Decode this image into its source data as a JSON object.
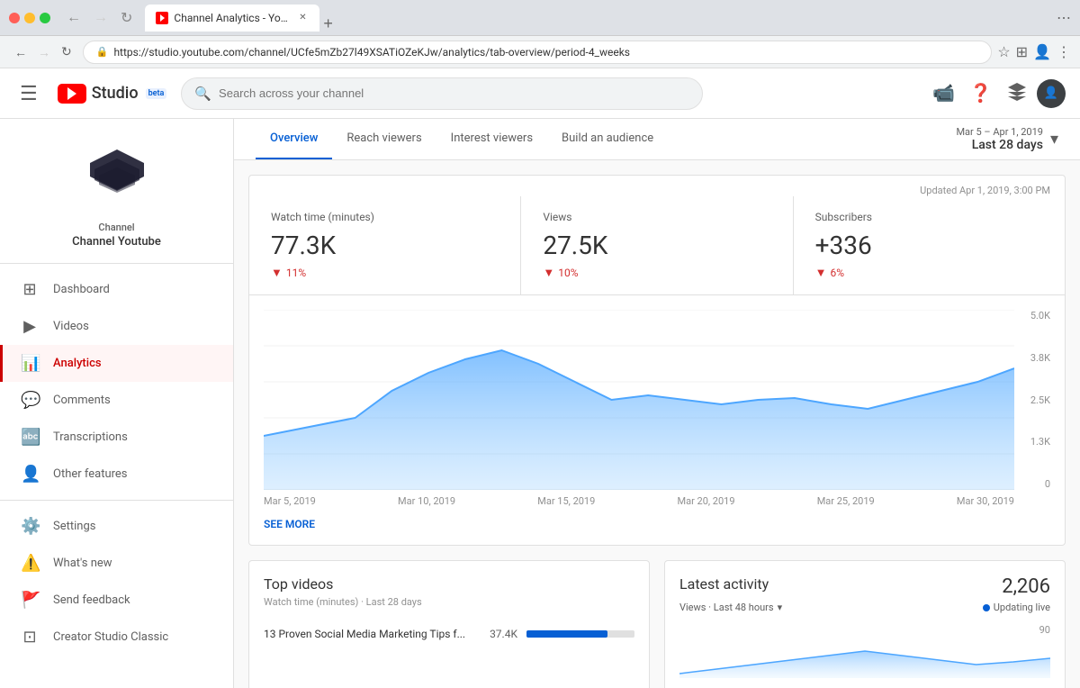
{
  "browser": {
    "tab_title": "Channel Analytics - YouTube S...",
    "url": "https://studio.youtube.com/channel/UCfe5mZb27l49XSATiOZeKJw/analytics/tab-overview/period-4_weeks",
    "back_label": "←",
    "forward_label": "→",
    "reload_label": "↻",
    "new_tab_label": "+"
  },
  "topbar": {
    "search_placeholder": "Search across your channel",
    "logo_text": "Studio",
    "beta_label": "beta",
    "create_icon": "video-camera-icon",
    "help_icon": "help-circle-icon",
    "layers_icon": "layers-icon"
  },
  "sidebar": {
    "channel_label": "Channel",
    "channel_name": "Channel Youtube",
    "items": [
      {
        "id": "dashboard",
        "label": "Dashboard",
        "icon": "dashboard-icon"
      },
      {
        "id": "videos",
        "label": "Videos",
        "icon": "videos-icon"
      },
      {
        "id": "analytics",
        "label": "Analytics",
        "icon": "analytics-icon",
        "active": true
      },
      {
        "id": "comments",
        "label": "Comments",
        "icon": "comments-icon"
      },
      {
        "id": "transcriptions",
        "label": "Transcriptions",
        "icon": "transcriptions-icon"
      },
      {
        "id": "other-features",
        "label": "Other features",
        "icon": "other-icon"
      },
      {
        "id": "settings",
        "label": "Settings",
        "icon": "settings-icon"
      },
      {
        "id": "whats-new",
        "label": "What's new",
        "icon": "whats-new-icon"
      },
      {
        "id": "send-feedback",
        "label": "Send feedback",
        "icon": "feedback-icon"
      },
      {
        "id": "creator-studio-classic",
        "label": "Creator Studio Classic",
        "icon": "classic-icon"
      }
    ]
  },
  "analytics": {
    "tabs": [
      {
        "id": "overview",
        "label": "Overview",
        "active": true
      },
      {
        "id": "reach-viewers",
        "label": "Reach viewers",
        "active": false
      },
      {
        "id": "interest-viewers",
        "label": "Interest viewers",
        "active": false
      },
      {
        "id": "build-audience",
        "label": "Build an audience",
        "active": false
      }
    ],
    "date_range": {
      "dates": "Mar 5 – Apr 1, 2019",
      "period": "Last 28 days"
    },
    "updated_text": "Updated Apr 1, 2019, 3:00 PM",
    "stats": [
      {
        "label": "Watch time (minutes)",
        "value": "77.3K",
        "delta": "11%",
        "delta_direction": "down"
      },
      {
        "label": "Views",
        "value": "27.5K",
        "delta": "10%",
        "delta_direction": "down"
      },
      {
        "label": "Subscribers",
        "value": "+336",
        "delta": "6%",
        "delta_direction": "down"
      }
    ],
    "chart": {
      "y_labels": [
        "5.0K",
        "3.8K",
        "2.5K",
        "1.3K",
        "0"
      ],
      "x_labels": [
        "Mar 5, 2019",
        "Mar 10, 2019",
        "Mar 15, 2019",
        "Mar 20, 2019",
        "Mar 25, 2019",
        "Mar 30, 2019"
      ]
    },
    "see_more_label": "SEE MORE",
    "top_videos": {
      "title": "Top videos",
      "subtitle": "Watch time (minutes) · Last 28 days",
      "videos": [
        {
          "title": "13 Proven Social Media Marketing Tips f...",
          "value": "37.4K",
          "bar_pct": 75
        }
      ]
    },
    "latest_activity": {
      "title": "Latest activity",
      "value": "2,206",
      "subtitle": "Views · Last 48 hours",
      "live_label": "Updating live",
      "chart_value": "90"
    }
  }
}
